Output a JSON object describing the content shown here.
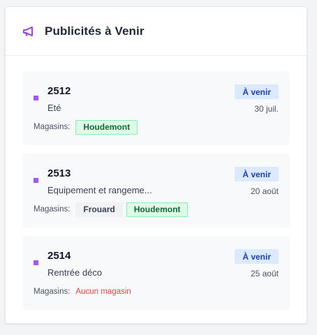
{
  "panel": {
    "title": "Publicités à Venir",
    "icon": "megaphone-icon",
    "accent_color": "#9333ea"
  },
  "stores_label": "Magasins:",
  "items": [
    {
      "number": "2512",
      "name": "Eté",
      "badge": "À venir",
      "date": "30 juil.",
      "stores": [
        {
          "name": "Houdemont",
          "style": "green"
        }
      ]
    },
    {
      "number": "2513",
      "name": "Equipement et rangeme...",
      "badge": "À venir",
      "date": "20 août",
      "stores": [
        {
          "name": "Frouard",
          "style": "gray"
        },
        {
          "name": "Houdemont",
          "style": "green"
        }
      ]
    },
    {
      "number": "2514",
      "name": "Rentrée déco",
      "badge": "À venir",
      "date": "25 août",
      "stores": [],
      "no_stores_text": "Aucun magasin"
    }
  ]
}
